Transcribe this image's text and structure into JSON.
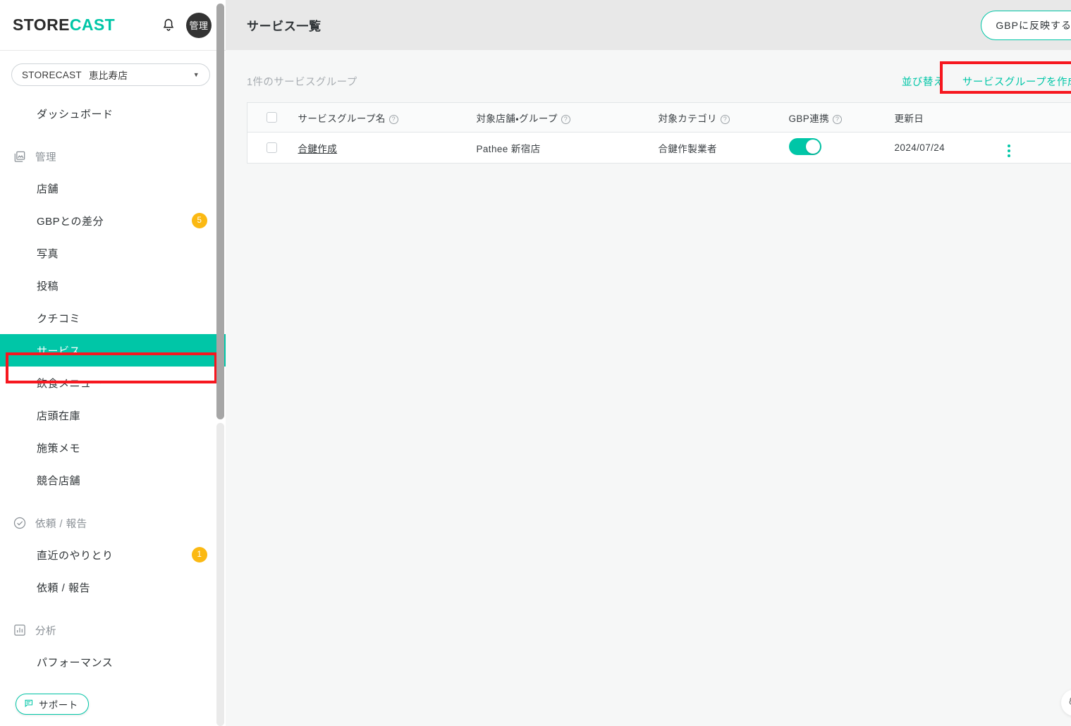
{
  "brand": {
    "logo_first": "STORE",
    "logo_second": "CAST",
    "accent_color": "#00c6a7",
    "badge_color": "#fbb913",
    "highlight_color": "#f6171f"
  },
  "topbar": {
    "bell_icon": "bell-icon",
    "avatar_label": "管理"
  },
  "store_selector": {
    "brand": "STORECAST",
    "store": "恵比寿店",
    "caret_icon": "chevron-down-icon"
  },
  "sidebar": {
    "dashboard": {
      "label": "ダッシュボード"
    },
    "sections": [
      {
        "icon": "images-icon",
        "label": "管理",
        "items": [
          {
            "label": "店舗",
            "badge": "",
            "active": false
          },
          {
            "label": "GBPとの差分",
            "badge": "5",
            "active": false
          },
          {
            "label": "写真",
            "badge": "",
            "active": false
          },
          {
            "label": "投稿",
            "badge": "",
            "active": false
          },
          {
            "label": "クチコミ",
            "badge": "",
            "active": false
          },
          {
            "label": "サービス",
            "badge": "",
            "active": true
          },
          {
            "label": "飲食メニュー",
            "badge": "",
            "active": false
          },
          {
            "label": "店頭在庫",
            "badge": "",
            "active": false
          },
          {
            "label": "施策メモ",
            "badge": "",
            "active": false
          },
          {
            "label": "競合店舗",
            "badge": "",
            "active": false
          }
        ]
      },
      {
        "icon": "check-circle-icon",
        "label": "依頼 / 報告",
        "items": [
          {
            "label": "直近のやりとり",
            "badge": "1",
            "active": false
          },
          {
            "label": "依頼 / 報告",
            "badge": "",
            "active": false
          }
        ]
      },
      {
        "icon": "bar-chart-icon",
        "label": "分析",
        "items": [
          {
            "label": "パフォーマンス",
            "badge": "",
            "active": false
          }
        ]
      }
    ],
    "support_button": {
      "label": "サポート",
      "icon": "chat-icon"
    }
  },
  "main": {
    "page_title": "サービス一覧",
    "gbp_button": "GBPに反映する",
    "count_label": "1件のサービスグループ",
    "sort_link": "並び替え",
    "create_link": "サービスグループを作成",
    "table": {
      "columns": [
        {
          "label": "サービスグループ名",
          "help": true
        },
        {
          "label": "対象店舗・グループ",
          "help": true
        },
        {
          "label": "対象カテゴリ",
          "help": true
        },
        {
          "label": "GBP連携",
          "help": true
        },
        {
          "label": "更新日",
          "help": false
        }
      ],
      "rows": [
        {
          "name": "合鍵作成",
          "store": "Pathee 新宿店",
          "category": "合鍵作製業者",
          "gbp_enabled": "on",
          "updated": "2024/07/24"
        }
      ]
    },
    "assistant_badge_icon": "openai-logo-icon"
  }
}
